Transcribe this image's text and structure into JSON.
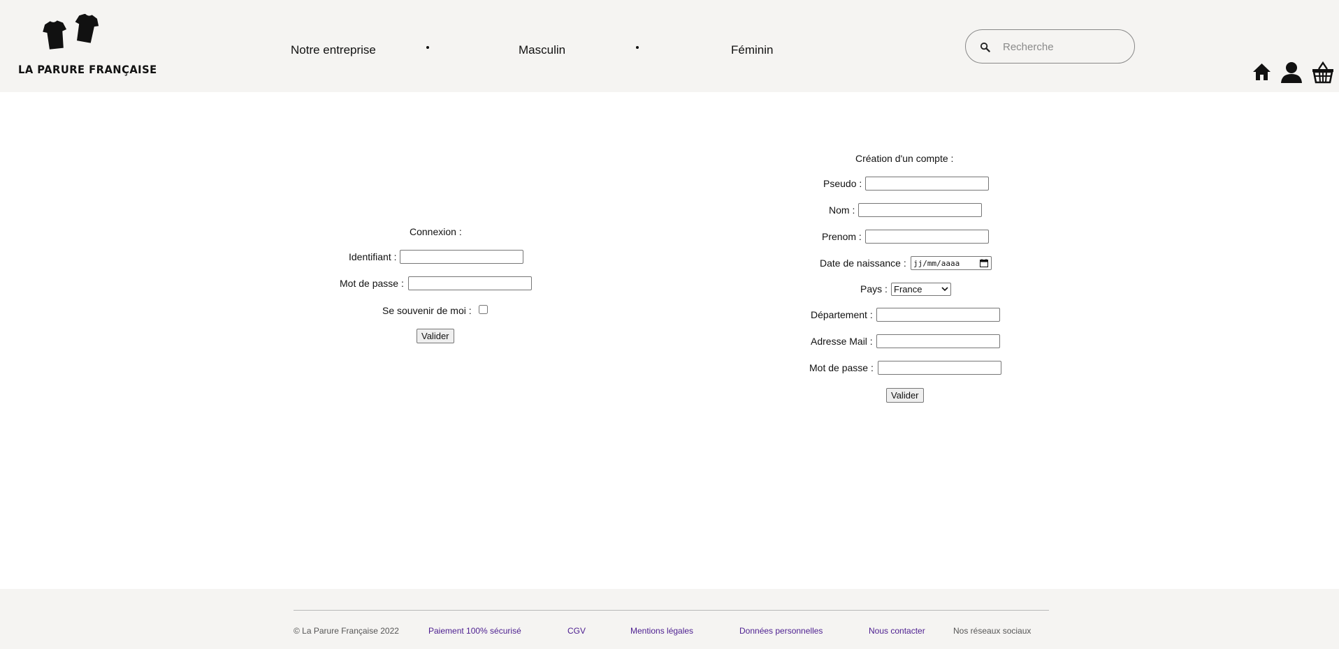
{
  "header": {
    "logo_text": "LA PARURE FRANÇAISE",
    "nav": [
      "Notre entreprise",
      "Masculin",
      "Féminin"
    ],
    "search_placeholder": "Recherche",
    "icons": [
      "search-icon",
      "home-icon",
      "user-icon",
      "basket-icon"
    ]
  },
  "login": {
    "title": "Connexion :",
    "identifier_label": "Identifiant :",
    "password_label": "Mot de passe :",
    "remember_label": "Se souvenir de moi :",
    "submit": "Valider"
  },
  "signup": {
    "title": "Création d'un compte :",
    "pseudo_label": "Pseudo :",
    "nom_label": "Nom :",
    "prenom_label": "Prenom :",
    "birthdate_label": "Date de naissance :",
    "birthdate_placeholder": "jj/mm/aaaa",
    "country_label": "Pays :",
    "country_value": "France",
    "department_label": "Département :",
    "email_label": "Adresse Mail :",
    "password_label": "Mot de passe :",
    "submit": "Valider"
  },
  "footer": {
    "copyright": "© La Parure Française 2022",
    "links": [
      "Paiement 100% sécurisé",
      "CGV",
      "Mentions légales",
      "Données personnelles",
      "Nous contacter"
    ],
    "social": "Nos réseaux sociaux"
  },
  "colors": {
    "header_bg": "#f5f4f2",
    "footer_bg": "#f5f4f2",
    "link": "#4b1d8f"
  }
}
